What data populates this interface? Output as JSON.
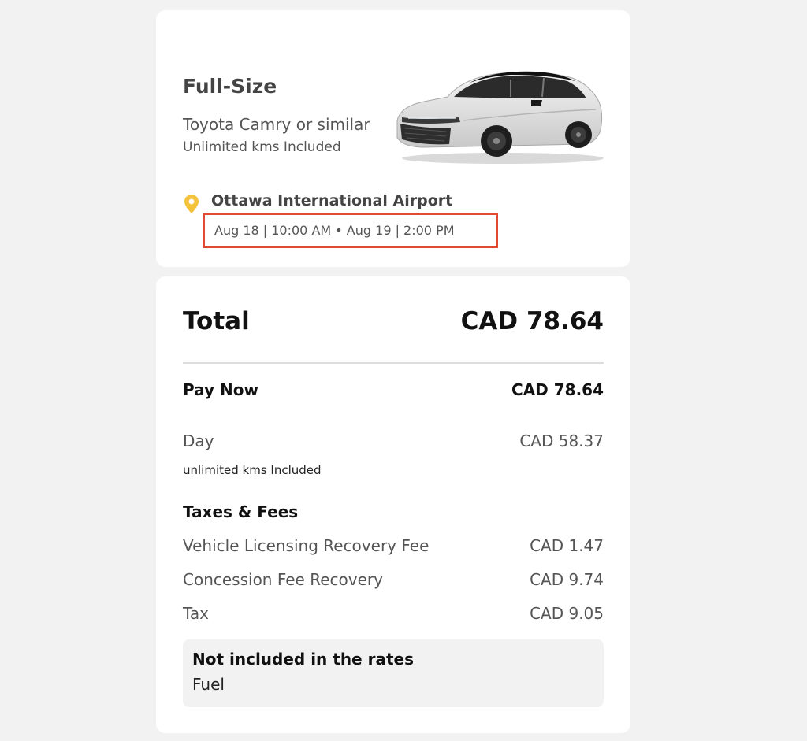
{
  "vehicle": {
    "class": "Full-Size",
    "model": "Toyota Camry or similar",
    "mileage": "Unlimited kms Included",
    "image_icon": "car-image",
    "pin_color": "#f5c33b"
  },
  "location": {
    "name": "Ottawa International Airport",
    "dates": "Aug 18 | 10:00 AM • Aug 19 | 2:00 PM",
    "highlight_color": "#e04a33"
  },
  "pricing": {
    "total_label": "Total",
    "total_value": "CAD 78.64",
    "pay_now_label": "Pay Now",
    "pay_now_value": "CAD 78.64",
    "day_label": "Day",
    "day_value": "CAD 58.37",
    "day_note": "unlimited kms Included",
    "taxes_heading": "Taxes & Fees",
    "fees": [
      {
        "label": "Vehicle Licensing Recovery Fee",
        "value": "CAD 1.47"
      },
      {
        "label": "Concession Fee Recovery",
        "value": "CAD 9.74"
      },
      {
        "label": "Tax",
        "value": "CAD 9.05"
      }
    ],
    "not_included_title": "Not included in the rates",
    "not_included_items": "Fuel"
  }
}
